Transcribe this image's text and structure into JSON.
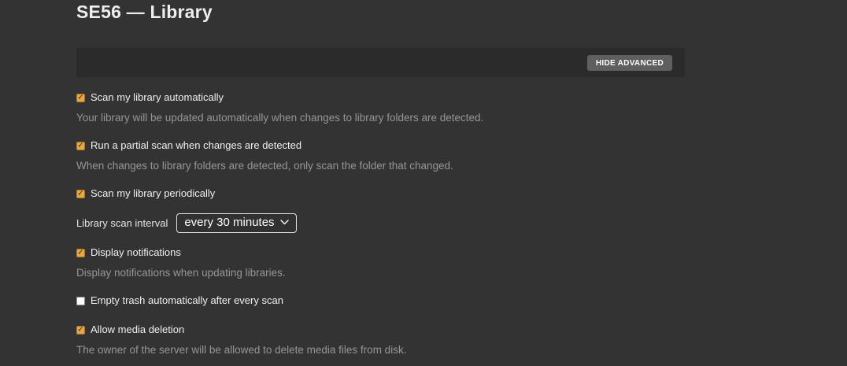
{
  "page": {
    "title": "SE56 — Library"
  },
  "advanced_bar": {
    "hide_advanced_label": "HIDE ADVANCED"
  },
  "icons": {
    "checkmark": "✓"
  },
  "colors": {
    "page_background": "#333333",
    "advanced_bar_background": "#2b2b2b",
    "button_background": "#5f5f5f",
    "checkbox_checked": "#e7a93f",
    "label_text": "#efefef",
    "description_text": "#969696"
  },
  "settings": {
    "scan_automatically": {
      "label": "Scan my library automatically",
      "checked": true,
      "description": "Your library will be updated automatically when changes to library folders are detected."
    },
    "partial_scan": {
      "label": "Run a partial scan when changes are detected",
      "checked": true,
      "description": "When changes to library folders are detected, only scan the folder that changed."
    },
    "scan_periodically": {
      "label": "Scan my library periodically",
      "checked": true
    },
    "scan_interval": {
      "label": "Library scan interval",
      "value": "every 30 minutes"
    },
    "display_notifications": {
      "label": "Display notifications",
      "checked": true,
      "description": "Display notifications when updating libraries."
    },
    "empty_trash": {
      "label": "Empty trash automatically after every scan",
      "checked": false
    },
    "allow_media_deletion": {
      "label": "Allow media deletion",
      "checked": true,
      "description": "The owner of the server will be allowed to delete media files from disk."
    }
  }
}
